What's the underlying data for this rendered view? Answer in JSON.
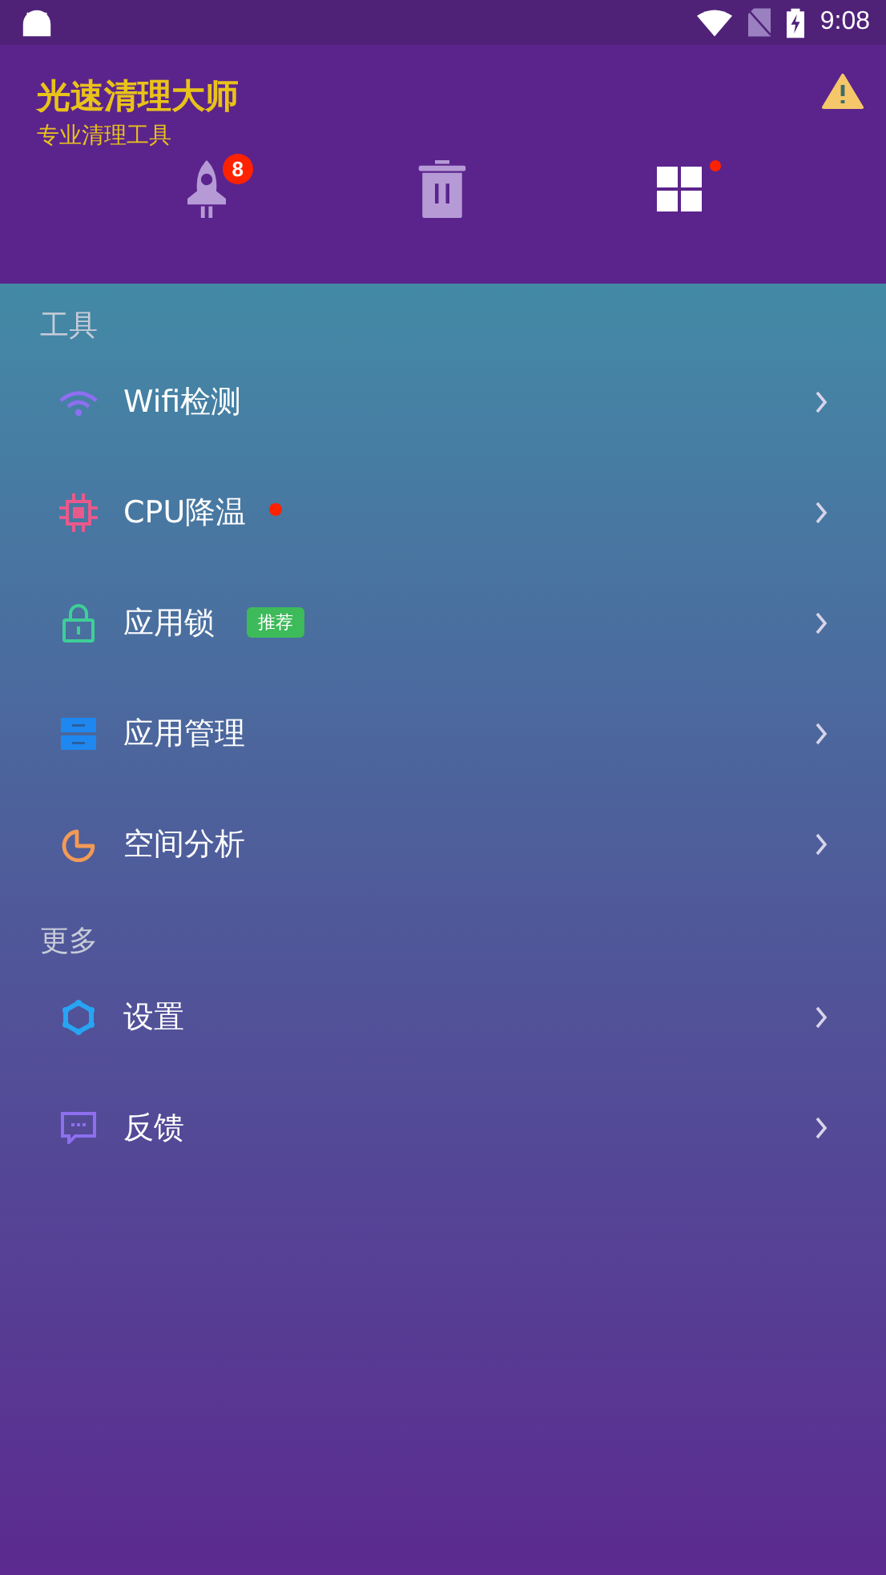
{
  "status_bar": {
    "time": "9:08"
  },
  "header": {
    "title": "光速清理大师",
    "subtitle": "专业清理工具"
  },
  "tabs": [
    {
      "badge": "8",
      "dot": false,
      "selected": false
    },
    {
      "dot": false,
      "selected": false
    },
    {
      "dot": true,
      "selected": true
    }
  ],
  "sections": [
    {
      "title": "工具",
      "items": [
        {
          "label": "Wifi检测",
          "dot": false
        },
        {
          "label": "CPU降温",
          "dot": true
        },
        {
          "label": "应用锁",
          "dot": false,
          "badge": "推荐"
        },
        {
          "label": "应用管理",
          "dot": false
        },
        {
          "label": "空间分析",
          "dot": false
        }
      ]
    },
    {
      "title": "更多",
      "items": [
        {
          "label": "设置",
          "dot": false
        },
        {
          "label": "反馈",
          "dot": false
        }
      ]
    }
  ]
}
